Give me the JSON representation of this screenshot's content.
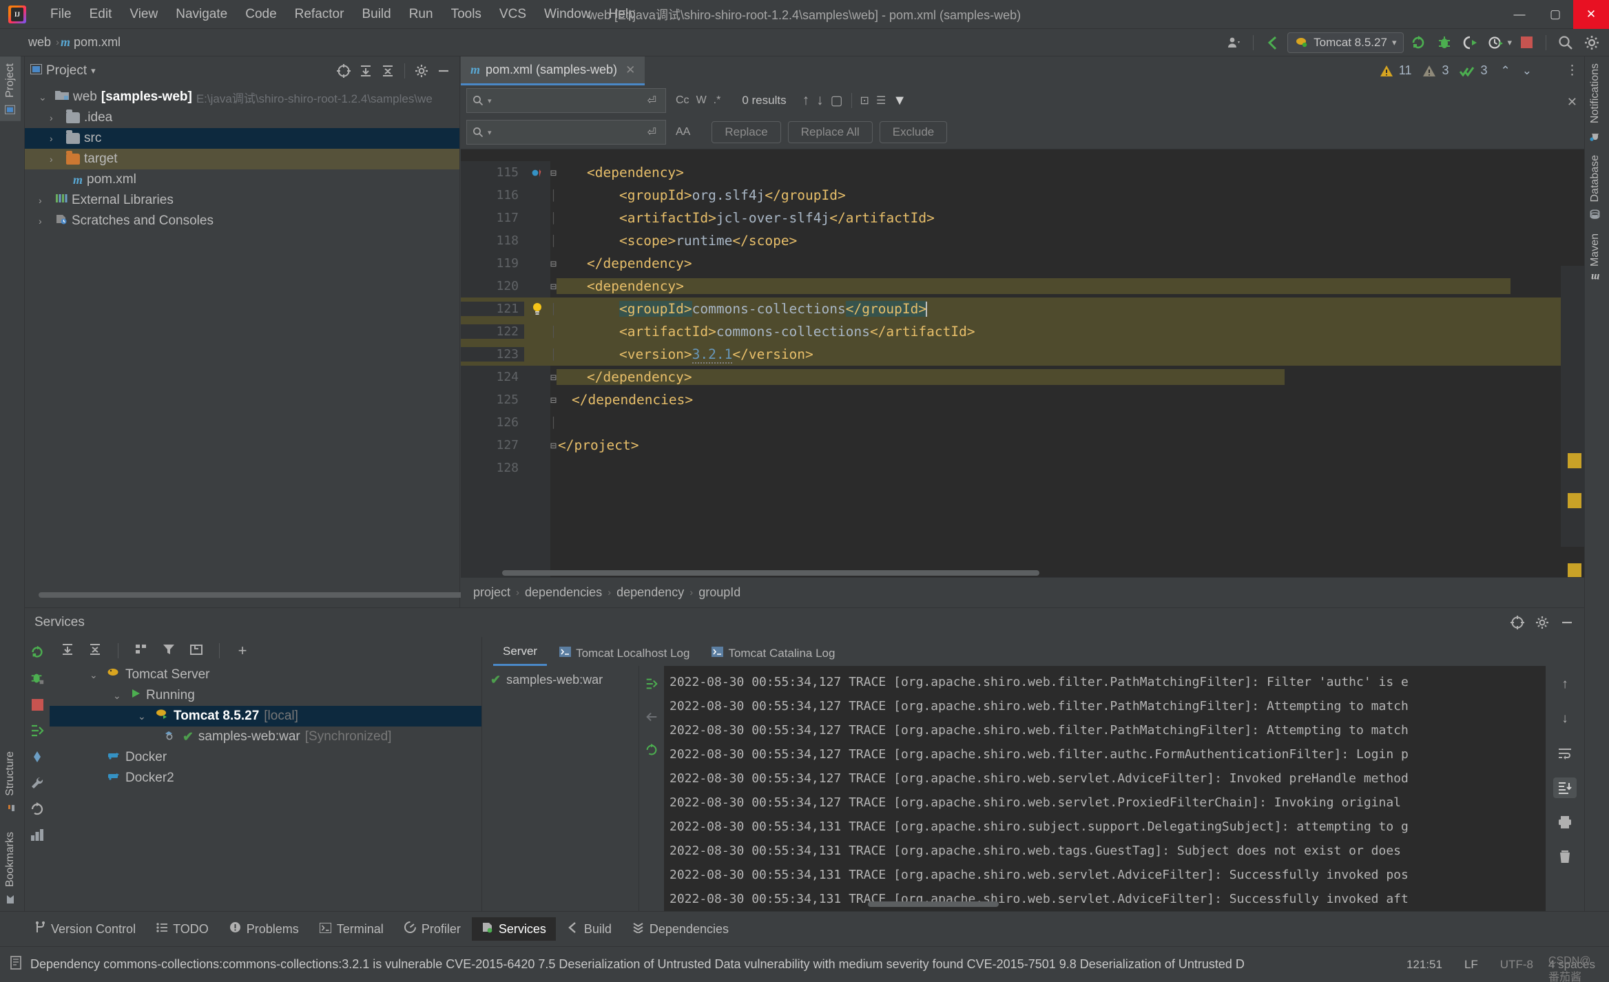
{
  "window": {
    "title": "web [E:\\java调试\\shiro-shiro-root-1.2.4\\samples\\web] - pom.xml (samples-web)",
    "minimize": "—",
    "maximize": "▢",
    "close": "✕"
  },
  "menubar": {
    "items": [
      "File",
      "Edit",
      "View",
      "Navigate",
      "Code",
      "Refactor",
      "Build",
      "Run",
      "Tools",
      "VCS",
      "Window",
      "Help"
    ]
  },
  "navbar": {
    "crumbs": [
      "web",
      "pom.xml"
    ],
    "run_config": "Tomcat 8.5.27",
    "icons": {
      "user": "user-icon",
      "back": "back-arrow-icon",
      "rerun": "rerun-icon",
      "debug": "debug-icon",
      "coverage": "coverage-icon",
      "profile": "profile-icon",
      "stop": "stop-icon",
      "search": "search-icon",
      "settings": "gear-icon"
    }
  },
  "left_strip": {
    "top": [
      {
        "label": "Project",
        "active": true
      }
    ],
    "bottom": [
      {
        "label": "Structure",
        "active": false
      },
      {
        "label": "Bookmarks",
        "active": false
      }
    ]
  },
  "right_strip": {
    "items": [
      {
        "label": "Notifications",
        "icon": "bell-icon"
      },
      {
        "label": "Database",
        "icon": "database-icon"
      },
      {
        "label": "Maven",
        "icon": "maven-icon"
      }
    ]
  },
  "project_panel": {
    "title": "Project",
    "tree": [
      {
        "label": "web",
        "bold_label": "[samples-web]",
        "path": "E:\\java调试\\shiro-shiro-root-1.2.4\\samples\\we",
        "arrow": "v",
        "icon": "module-icon",
        "indent": 0,
        "state": "none"
      },
      {
        "label": ".idea",
        "arrow": ">",
        "icon": "folder-icon",
        "indent": 1,
        "state": "none"
      },
      {
        "label": "src",
        "arrow": ">",
        "icon": "folder-icon",
        "indent": 1,
        "state": "selected-blue"
      },
      {
        "label": "target",
        "arrow": ">",
        "icon": "folder-orange-icon",
        "indent": 1,
        "state": "selected-olive"
      },
      {
        "label": "pom.xml",
        "arrow": "",
        "icon": "maven-file-icon",
        "indent": 1,
        "state": "none"
      },
      {
        "label": "External Libraries",
        "arrow": ">",
        "icon": "libraries-icon",
        "indent": 0,
        "state": "none"
      },
      {
        "label": "Scratches and Consoles",
        "arrow": ">",
        "icon": "scratches-icon",
        "indent": 0,
        "state": "none"
      }
    ]
  },
  "editor": {
    "tab": {
      "label": "pom.xml (samples-web)",
      "icon": "maven-file-icon",
      "close": "✕"
    },
    "find": {
      "search_placeholder": "",
      "replace_placeholder": "",
      "results_text": "0 results",
      "buttons": [
        "Replace",
        "Replace All",
        "Exclude"
      ],
      "toggles": [
        "Cc",
        "W",
        ".*"
      ],
      "icons": [
        "prev-match-icon",
        "next-match-icon",
        "select-all-icon",
        "filter-icon"
      ]
    },
    "inspections": {
      "warnings": "11",
      "weak_warnings": "3",
      "checks": "3"
    },
    "breadcrumbs": [
      "project",
      "dependencies",
      "dependency",
      "groupId"
    ],
    "lines": [
      {
        "n": "115",
        "indent": 2,
        "tokens": [
          {
            "t": "<dependency>",
            "c": "tag"
          }
        ],
        "fold": "-",
        "highlight": "none",
        "gutter": "breakpoint-arrow"
      },
      {
        "n": "116",
        "indent": 3,
        "tokens": [
          {
            "t": "<groupId>",
            "c": "tag"
          },
          {
            "t": "org.slf4j",
            "c": "val"
          },
          {
            "t": "</groupId>",
            "c": "tag"
          }
        ],
        "fold": "",
        "highlight": "none"
      },
      {
        "n": "117",
        "indent": 3,
        "tokens": [
          {
            "t": "<artifactId>",
            "c": "tag"
          },
          {
            "t": "jcl-over-slf4j",
            "c": "val"
          },
          {
            "t": "</artifactId>",
            "c": "tag"
          }
        ],
        "fold": "",
        "highlight": "none"
      },
      {
        "n": "118",
        "indent": 3,
        "tokens": [
          {
            "t": "<scope>",
            "c": "tag"
          },
          {
            "t": "runtime",
            "c": "val"
          },
          {
            "t": "</scope>",
            "c": "tag"
          }
        ],
        "fold": "",
        "highlight": "none"
      },
      {
        "n": "119",
        "indent": 2,
        "tokens": [
          {
            "t": "</dependency>",
            "c": "tag"
          }
        ],
        "fold": "-",
        "highlight": "none"
      },
      {
        "n": "120",
        "indent": 2,
        "tokens": [
          {
            "t": "<dependency>",
            "c": "tag"
          }
        ],
        "fold": "-",
        "highlight": "olive"
      },
      {
        "n": "121",
        "indent": 3,
        "tokens": [
          {
            "t": "<groupId>",
            "c": "tag search"
          },
          {
            "t": "commons-collections",
            "c": "val"
          },
          {
            "t": "</groupId>",
            "c": "tag search"
          }
        ],
        "fold": "",
        "highlight": "olive",
        "gutter": "bulb",
        "caret": true
      },
      {
        "n": "122",
        "indent": 3,
        "tokens": [
          {
            "t": "<artifactId>",
            "c": "tag"
          },
          {
            "t": "commons-collections",
            "c": "val"
          },
          {
            "t": "</artifactId>",
            "c": "tag"
          }
        ],
        "fold": "",
        "highlight": "olive"
      },
      {
        "n": "123",
        "indent": 3,
        "tokens": [
          {
            "t": "<version>",
            "c": "tag"
          },
          {
            "t": "3.2.1",
            "c": "num"
          },
          {
            "t": "</version>",
            "c": "tag"
          }
        ],
        "fold": "",
        "highlight": "olive"
      },
      {
        "n": "124",
        "indent": 2,
        "tokens": [
          {
            "t": "</dependency>",
            "c": "tag"
          }
        ],
        "fold": "-",
        "highlight": "olive"
      },
      {
        "n": "125",
        "indent": 1,
        "tokens": [
          {
            "t": "</dependencies>",
            "c": "tag"
          }
        ],
        "fold": "-",
        "highlight": "none"
      },
      {
        "n": "126",
        "indent": 0,
        "tokens": [],
        "fold": "",
        "highlight": "none"
      },
      {
        "n": "127",
        "indent": 0,
        "tokens": [
          {
            "t": "</project>",
            "c": "tag"
          }
        ],
        "fold": "-",
        "highlight": "none"
      },
      {
        "n": "128",
        "indent": 0,
        "tokens": [],
        "fold": "",
        "highlight": "none"
      }
    ]
  },
  "services": {
    "title": "Services",
    "tree": [
      {
        "label": "Tomcat Server",
        "arrow": "v",
        "icon": "tomcat-icon",
        "indent": 1,
        "state": "none"
      },
      {
        "label": "Running",
        "arrow": "v",
        "icon": "run-icon",
        "indent": 2,
        "state": "none"
      },
      {
        "label": "Tomcat 8.5.27",
        "suffix": "[local]",
        "arrow": "v",
        "icon": "tomcat-icon",
        "indent": 3,
        "state": "selected",
        "bold": true
      },
      {
        "label": "samples-web:war",
        "suffix": "[Synchronized]",
        "arrow": "",
        "icon": "artifact-icon",
        "indent": 4,
        "state": "none"
      },
      {
        "label": "Docker",
        "arrow": "",
        "icon": "docker-icon",
        "indent": 1,
        "state": "none"
      },
      {
        "label": "Docker2",
        "arrow": "",
        "icon": "docker-icon",
        "indent": 1,
        "state": "none"
      }
    ],
    "log_tabs": [
      {
        "label": "Server",
        "active": true,
        "icon": ""
      },
      {
        "label": "Tomcat Localhost Log",
        "active": false,
        "icon": "console-icon"
      },
      {
        "label": "Tomcat Catalina Log",
        "active": false,
        "icon": "console-icon"
      }
    ],
    "deploy_item": "samples-web:war",
    "log_lines": [
      "2022-08-30 00:55:34,127 TRACE [org.apache.shiro.web.filter.PathMatchingFilter]: Filter 'authc' is e",
      "2022-08-30 00:55:34,127 TRACE [org.apache.shiro.web.filter.PathMatchingFilter]: Attempting to match",
      "2022-08-30 00:55:34,127 TRACE [org.apache.shiro.web.filter.PathMatchingFilter]: Attempting to match",
      "2022-08-30 00:55:34,127 TRACE [org.apache.shiro.web.filter.authc.FormAuthenticationFilter]: Login p",
      "2022-08-30 00:55:34,127 TRACE [org.apache.shiro.web.servlet.AdviceFilter]: Invoked preHandle method",
      "2022-08-30 00:55:34,127 TRACE [org.apache.shiro.web.servlet.ProxiedFilterChain]: Invoking original",
      "2022-08-30 00:55:34,131 TRACE [org.apache.shiro.subject.support.DelegatingSubject]: attempting to g",
      "2022-08-30 00:55:34,131 TRACE [org.apache.shiro.web.tags.GuestTag]: Subject does not exist or does",
      "2022-08-30 00:55:34,131 TRACE [org.apache.shiro.web.servlet.AdviceFilter]: Successfully invoked pos",
      "2022-08-30 00:55:34,131 TRACE [org.apache.shiro.web.servlet.AdviceFilter]: Successfully invoked aft"
    ],
    "console_icons": [
      "scroll-up-icon",
      "scroll-down-icon",
      "soft-wrap-icon",
      "scroll-to-end-icon",
      "print-icon",
      "trash-icon"
    ]
  },
  "toolwindow_bar": {
    "items": [
      {
        "label": "Version Control",
        "icon": "branch-icon",
        "active": false
      },
      {
        "label": "TODO",
        "icon": "todo-icon",
        "active": false
      },
      {
        "label": "Problems",
        "icon": "problems-icon",
        "active": false
      },
      {
        "label": "Terminal",
        "icon": "terminal-icon",
        "active": false
      },
      {
        "label": "Profiler",
        "icon": "profiler-icon",
        "active": false
      },
      {
        "label": "Services",
        "icon": "services-icon",
        "active": true
      },
      {
        "label": "Build",
        "icon": "build-icon",
        "active": false
      },
      {
        "label": "Dependencies",
        "icon": "dependencies-icon",
        "active": false
      }
    ]
  },
  "statusbar": {
    "message": "Dependency commons-collections:commons-collections:3.2.1 is vulnerable CVE-2015-6420 7.5 Deserialization of Untrusted Data vulnerability with medium severity found CVE-2015-7501 9.8 Deserialization of Untrusted D",
    "caret_position": "121:51",
    "line_separator": "LF",
    "encoding": "UTF-8",
    "indent": "4 spaces",
    "watermark": "CSDN@番茄酱"
  },
  "colors": {
    "accent_blue": "#4a88c7",
    "olive_highlight": "#4f4b2d",
    "search_highlight": "#36534d",
    "tag_orange": "#e8bf6a",
    "number_blue": "#6897bb",
    "warning_yellow": "#c9a227",
    "selection_blue": "#0d293e",
    "editor_bg": "#2b2b2b",
    "panel_bg": "#3c3f41"
  }
}
